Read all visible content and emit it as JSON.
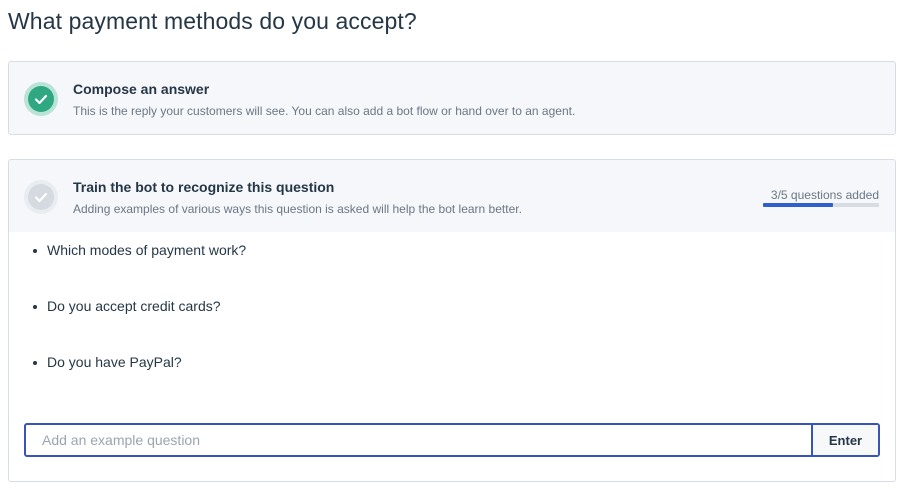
{
  "page": {
    "title": "What payment methods do you accept?"
  },
  "compose_step": {
    "title": "Compose an answer",
    "subtitle": "This is the reply your customers will see. You can also add a bot flow or hand over to an agent.",
    "status": "completed",
    "icon": "check-icon"
  },
  "train_step": {
    "title": "Train the bot to recognize this question",
    "subtitle": "Adding examples of various ways this question is asked will help the bot learn better.",
    "status": "in-progress",
    "icon": "check-icon",
    "progress": {
      "label": "3/5 questions added",
      "current": 3,
      "total": 5
    },
    "examples": [
      "Which modes of payment work?",
      "Do you accept credit cards?",
      "Do you have PayPal?"
    ],
    "input": {
      "placeholder": "Add an example question",
      "value": ""
    },
    "enter_label": "Enter"
  },
  "colors": {
    "success": "#2fa882",
    "progress": "#2f5fce",
    "input_border": "#3954b8"
  }
}
